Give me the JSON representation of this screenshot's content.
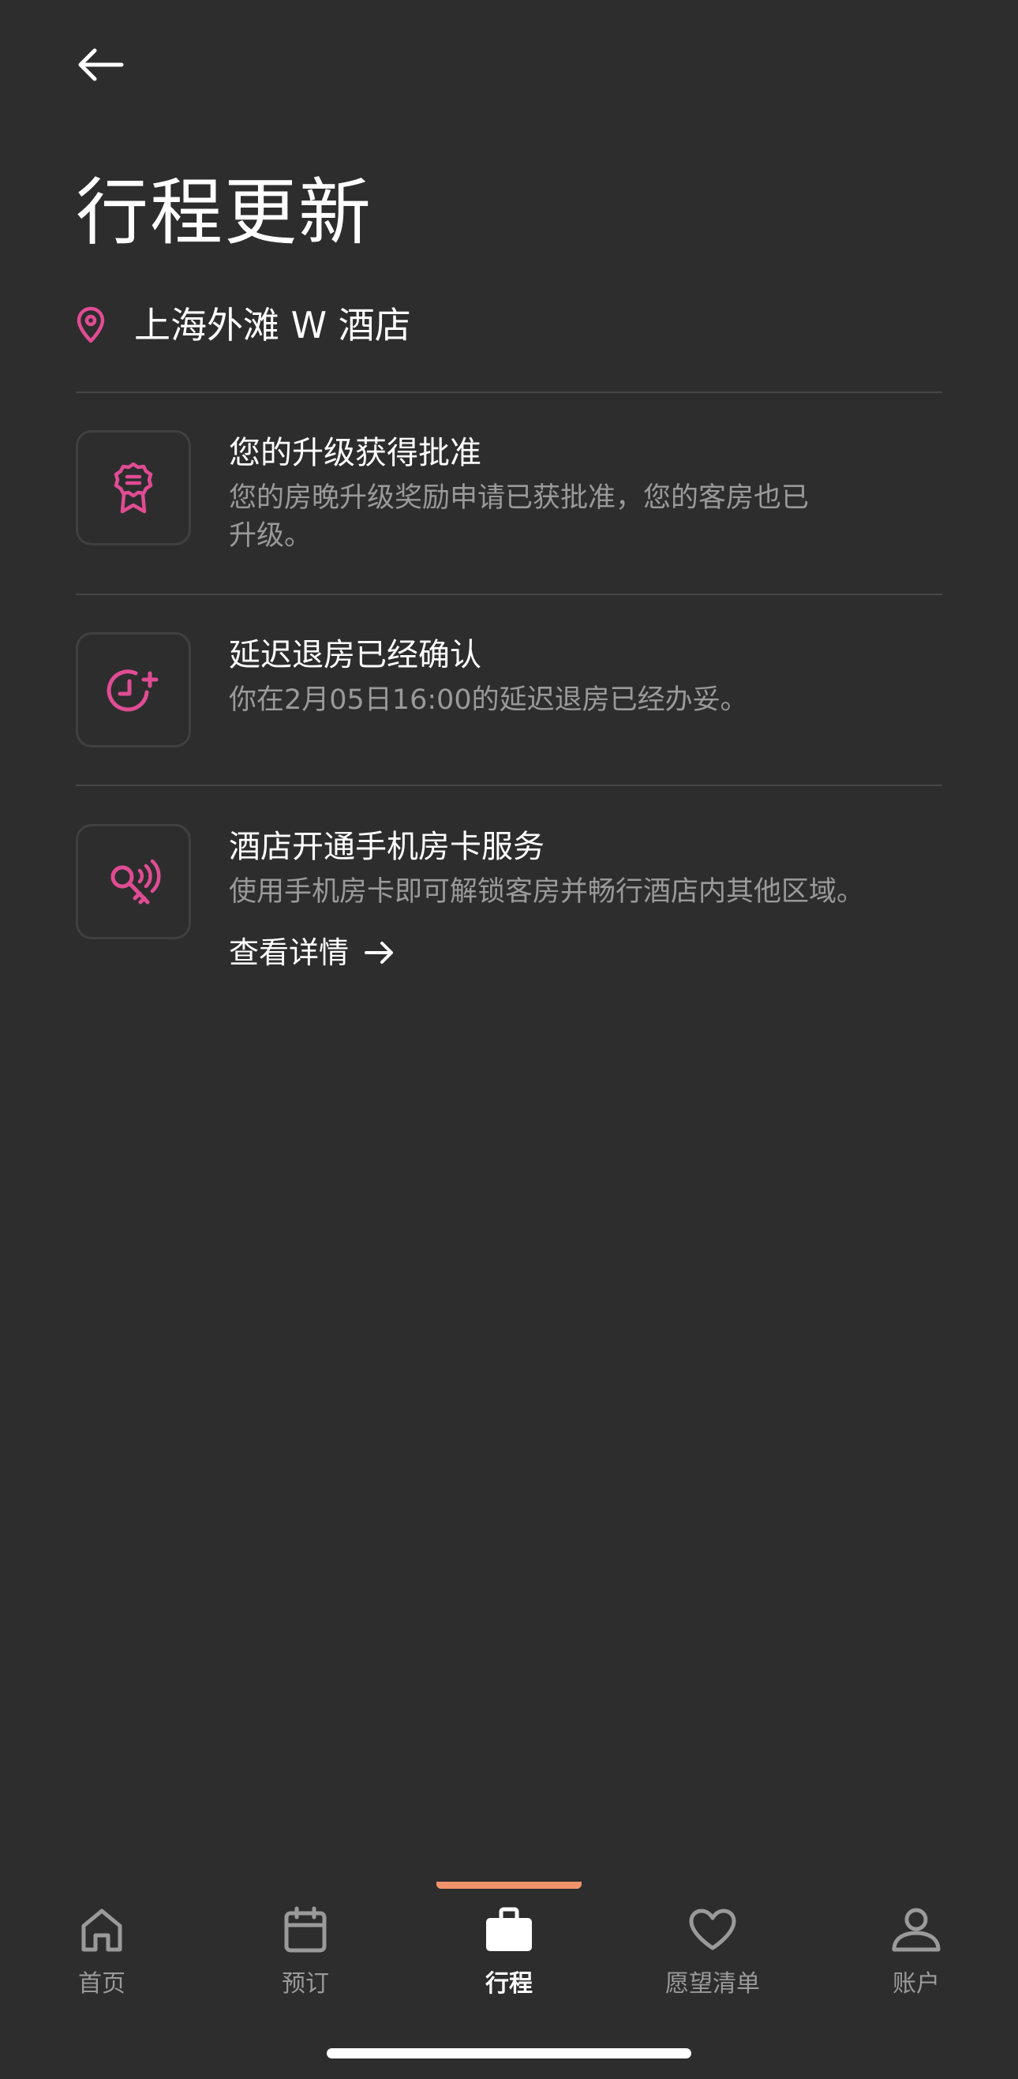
{
  "header": {
    "back_icon": "arrow-left-icon",
    "title": "行程更新"
  },
  "hotel": {
    "icon": "location-pin-icon",
    "name": "上海外滩 W 酒店"
  },
  "colors": {
    "background": "#2d2d2e",
    "accent_pink": "#e04c93",
    "active_indicator": "#f2936a",
    "muted_text": "#9a9a9b"
  },
  "notices": [
    {
      "icon": "award-ribbon-icon",
      "title": "您的升级获得批准",
      "description": "您的房晚升级奖励申请已获批准，您的客房也已升级。"
    },
    {
      "icon": "clock-plus-icon",
      "title": "延迟退房已经确认",
      "description": "你在2月05日16:00的延迟退房已经办妥。"
    },
    {
      "icon": "mobile-key-icon",
      "title": "酒店开通手机房卡服务",
      "description": "使用手机房卡即可解锁客房并畅行酒店内其他区域。",
      "link_label": "查看详情",
      "link_icon": "arrow-right-icon"
    }
  ],
  "tabs": [
    {
      "label": "首页",
      "icon": "home-icon"
    },
    {
      "label": "预订",
      "icon": "calendar-icon"
    },
    {
      "label": "行程",
      "icon": "suitcase-icon",
      "active": true
    },
    {
      "label": "愿望清单",
      "icon": "heart-icon"
    },
    {
      "label": "账户",
      "icon": "user-icon"
    }
  ]
}
